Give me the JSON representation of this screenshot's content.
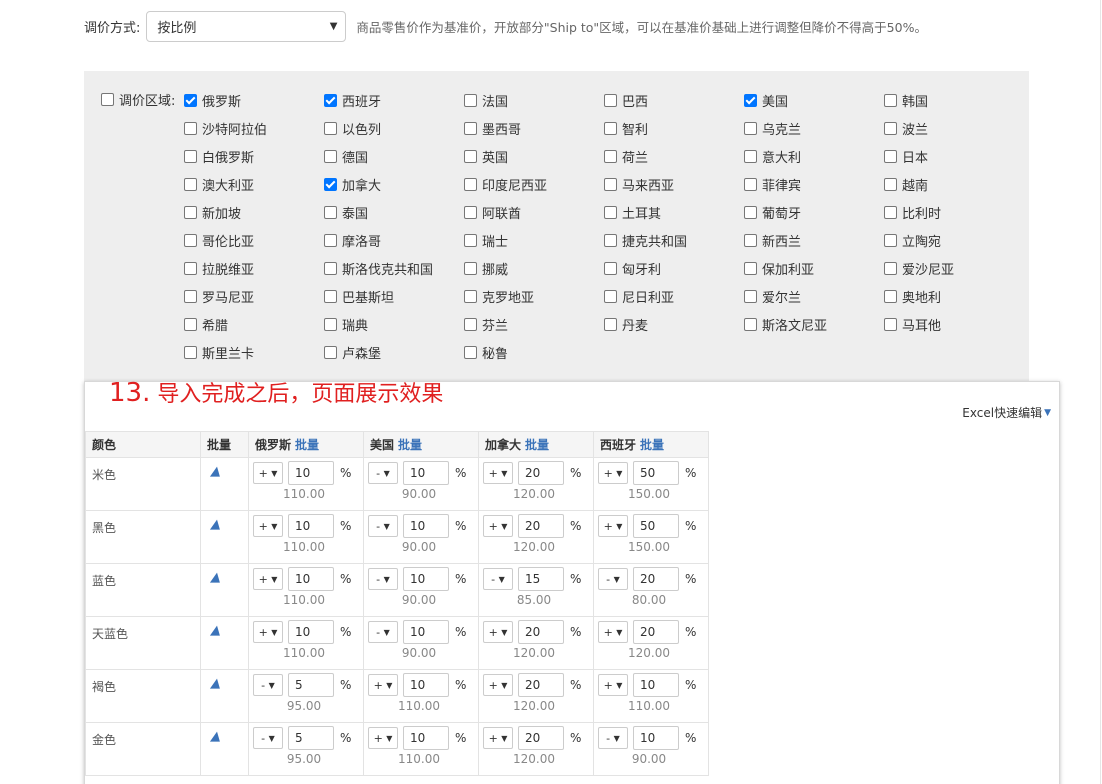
{
  "pricing_method": {
    "label": "调价方式:",
    "selected": "按比例",
    "hint": "商品零售价作为基准价，开放部分\"Ship to\"区域，可以在基准价基础上进行调整但降价不得高于50%。"
  },
  "regions": {
    "all_label": "调价区域:",
    "all_checked": false,
    "items": [
      {
        "label": "俄罗斯",
        "checked": true
      },
      {
        "label": "西班牙",
        "checked": true
      },
      {
        "label": "法国",
        "checked": false
      },
      {
        "label": "巴西",
        "checked": false
      },
      {
        "label": "美国",
        "checked": true
      },
      {
        "label": "韩国",
        "checked": false
      },
      {
        "label": "沙特阿拉伯",
        "checked": false
      },
      {
        "label": "以色列",
        "checked": false
      },
      {
        "label": "墨西哥",
        "checked": false
      },
      {
        "label": "智利",
        "checked": false
      },
      {
        "label": "乌克兰",
        "checked": false
      },
      {
        "label": "波兰",
        "checked": false
      },
      {
        "label": "白俄罗斯",
        "checked": false
      },
      {
        "label": "德国",
        "checked": false
      },
      {
        "label": "英国",
        "checked": false
      },
      {
        "label": "荷兰",
        "checked": false
      },
      {
        "label": "意大利",
        "checked": false
      },
      {
        "label": "日本",
        "checked": false
      },
      {
        "label": "澳大利亚",
        "checked": false
      },
      {
        "label": "加拿大",
        "checked": true
      },
      {
        "label": "印度尼西亚",
        "checked": false
      },
      {
        "label": "马来西亚",
        "checked": false
      },
      {
        "label": "菲律宾",
        "checked": false
      },
      {
        "label": "越南",
        "checked": false
      },
      {
        "label": "新加坡",
        "checked": false
      },
      {
        "label": "泰国",
        "checked": false
      },
      {
        "label": "阿联酋",
        "checked": false
      },
      {
        "label": "土耳其",
        "checked": false
      },
      {
        "label": "葡萄牙",
        "checked": false
      },
      {
        "label": "比利时",
        "checked": false
      },
      {
        "label": "哥伦比亚",
        "checked": false
      },
      {
        "label": "摩洛哥",
        "checked": false
      },
      {
        "label": "瑞士",
        "checked": false
      },
      {
        "label": "捷克共和国",
        "checked": false
      },
      {
        "label": "新西兰",
        "checked": false
      },
      {
        "label": "立陶宛",
        "checked": false
      },
      {
        "label": "拉脱维亚",
        "checked": false
      },
      {
        "label": "斯洛伐克共和国",
        "checked": false
      },
      {
        "label": "挪威",
        "checked": false
      },
      {
        "label": "匈牙利",
        "checked": false
      },
      {
        "label": "保加利亚",
        "checked": false
      },
      {
        "label": "爱沙尼亚",
        "checked": false
      },
      {
        "label": "罗马尼亚",
        "checked": false
      },
      {
        "label": "巴基斯坦",
        "checked": false
      },
      {
        "label": "克罗地亚",
        "checked": false
      },
      {
        "label": "尼日利亚",
        "checked": false
      },
      {
        "label": "爱尔兰",
        "checked": false
      },
      {
        "label": "奥地利",
        "checked": false
      },
      {
        "label": "希腊",
        "checked": false
      },
      {
        "label": "瑞典",
        "checked": false
      },
      {
        "label": "芬兰",
        "checked": false
      },
      {
        "label": "丹麦",
        "checked": false
      },
      {
        "label": "斯洛文尼亚",
        "checked": false
      },
      {
        "label": "马耳他",
        "checked": false
      },
      {
        "label": "斯里兰卡",
        "checked": false
      },
      {
        "label": "卢森堡",
        "checked": false
      },
      {
        "label": "秘鲁",
        "checked": false
      }
    ]
  },
  "step": {
    "number": "13.",
    "title": "导入完成之后，页面展示效果"
  },
  "excel_link": "Excel快速编辑",
  "table": {
    "color_header": "颜色",
    "batch_header": "批量",
    "batch_link": "批量",
    "batch_icon": "send-arrow-icon",
    "percent_sign": "%",
    "countries": [
      "俄罗斯",
      "美国",
      "加拿大",
      "西班牙"
    ],
    "rows": [
      {
        "color": "米色",
        "cells": [
          {
            "sign": "+",
            "value": "10",
            "price": "110.00"
          },
          {
            "sign": "-",
            "value": "10",
            "price": "90.00"
          },
          {
            "sign": "+",
            "value": "20",
            "price": "120.00"
          },
          {
            "sign": "+",
            "value": "50",
            "price": "150.00"
          }
        ]
      },
      {
        "color": "黑色",
        "cells": [
          {
            "sign": "+",
            "value": "10",
            "price": "110.00"
          },
          {
            "sign": "-",
            "value": "10",
            "price": "90.00"
          },
          {
            "sign": "+",
            "value": "20",
            "price": "120.00"
          },
          {
            "sign": "+",
            "value": "50",
            "price": "150.00"
          }
        ]
      },
      {
        "color": "蓝色",
        "cells": [
          {
            "sign": "+",
            "value": "10",
            "price": "110.00"
          },
          {
            "sign": "-",
            "value": "10",
            "price": "90.00"
          },
          {
            "sign": "-",
            "value": "15",
            "price": "85.00"
          },
          {
            "sign": "-",
            "value": "20",
            "price": "80.00"
          }
        ]
      },
      {
        "color": "天蓝色",
        "cells": [
          {
            "sign": "+",
            "value": "10",
            "price": "110.00"
          },
          {
            "sign": "-",
            "value": "10",
            "price": "90.00"
          },
          {
            "sign": "+",
            "value": "20",
            "price": "120.00"
          },
          {
            "sign": "+",
            "value": "20",
            "price": "120.00"
          }
        ]
      },
      {
        "color": "褐色",
        "cells": [
          {
            "sign": "-",
            "value": "5",
            "price": "95.00"
          },
          {
            "sign": "+",
            "value": "10",
            "price": "110.00"
          },
          {
            "sign": "+",
            "value": "20",
            "price": "120.00"
          },
          {
            "sign": "+",
            "value": "10",
            "price": "110.00"
          }
        ]
      },
      {
        "color": "金色",
        "cells": [
          {
            "sign": "-",
            "value": "5",
            "price": "95.00"
          },
          {
            "sign": "+",
            "value": "10",
            "price": "110.00"
          },
          {
            "sign": "+",
            "value": "20",
            "price": "120.00"
          },
          {
            "sign": "-",
            "value": "10",
            "price": "90.00"
          }
        ]
      }
    ]
  },
  "colors": {
    "checkbox_checked": "#0075ff",
    "panel_bg": "#eeeeee",
    "step_title": "#e02020",
    "link_blue": "#3b73b9"
  }
}
